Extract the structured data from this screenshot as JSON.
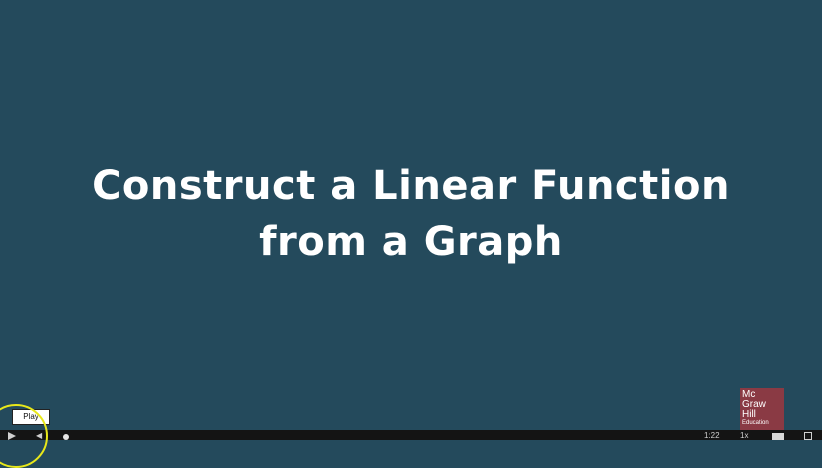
{
  "slide": {
    "title_line1": "Construct a Linear Function",
    "title_line2": "from a Graph",
    "background_color": "#244a5c"
  },
  "logo": {
    "line1": "Mc",
    "line2": "Graw",
    "line3": "Hill",
    "line4": "Education",
    "color": "#8a3a44"
  },
  "player": {
    "tooltip": "Play",
    "time": "1:22",
    "speed": "1x",
    "icons": [
      "play-icon",
      "volume-icon",
      "captions-icon",
      "fullscreen-icon"
    ]
  }
}
